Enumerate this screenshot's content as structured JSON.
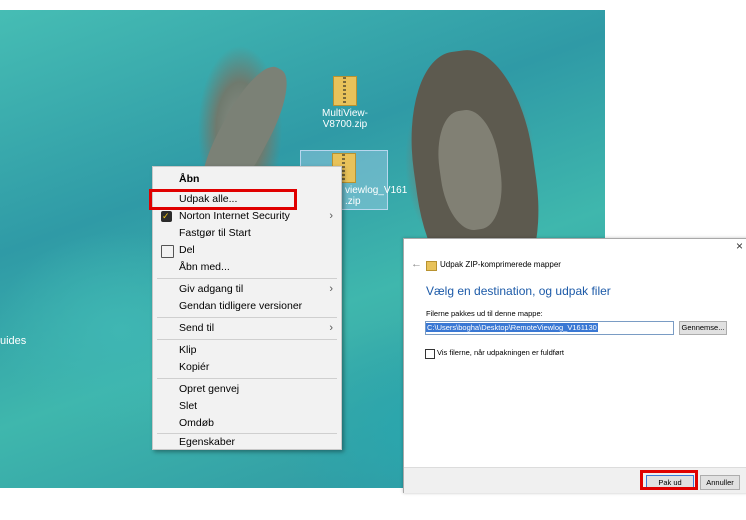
{
  "desktop": {
    "side_label": "uides",
    "icons": [
      {
        "label": "MultiView-V8700.zip",
        "icon": "zip-folder-icon"
      },
      {
        "label_line1": "viewlog_V161",
        "label_line2": ".zip",
        "icon": "zip-folder-icon"
      }
    ]
  },
  "context_menu": {
    "items": {
      "open": "Åbn",
      "extract_all": "Udpak alle...",
      "norton": "Norton Internet Security",
      "pin_start": "Fastgør til Start",
      "share": "Del",
      "open_with": "Åbn med...",
      "give_access": "Giv adgang til",
      "restore": "Gendan tidligere versioner",
      "send_to": "Send til",
      "cut": "Klip",
      "copy": "Kopiér",
      "create_shortcut": "Opret genvej",
      "delete": "Slet",
      "rename": "Omdøb",
      "properties": "Egenskaber"
    },
    "submenu_arrow": "›",
    "highlight_color": "#e00000"
  },
  "dialog": {
    "close": "×",
    "back": "←",
    "title": "Udpak ZIP-komprimerede mapper",
    "heading": "Vælg en destination, og udpak filer",
    "field_label": "Filerne pakkes ud til denne mappe:",
    "path_value": "C:\\Users\\bogha\\Desktop\\RemoteViewlog_V161130",
    "browse_label": "Gennemse...",
    "checkbox_label": "Vis filerne, når udpakningen er fuldført",
    "ok_label": "Pak ud",
    "cancel_label": "Annuller"
  }
}
